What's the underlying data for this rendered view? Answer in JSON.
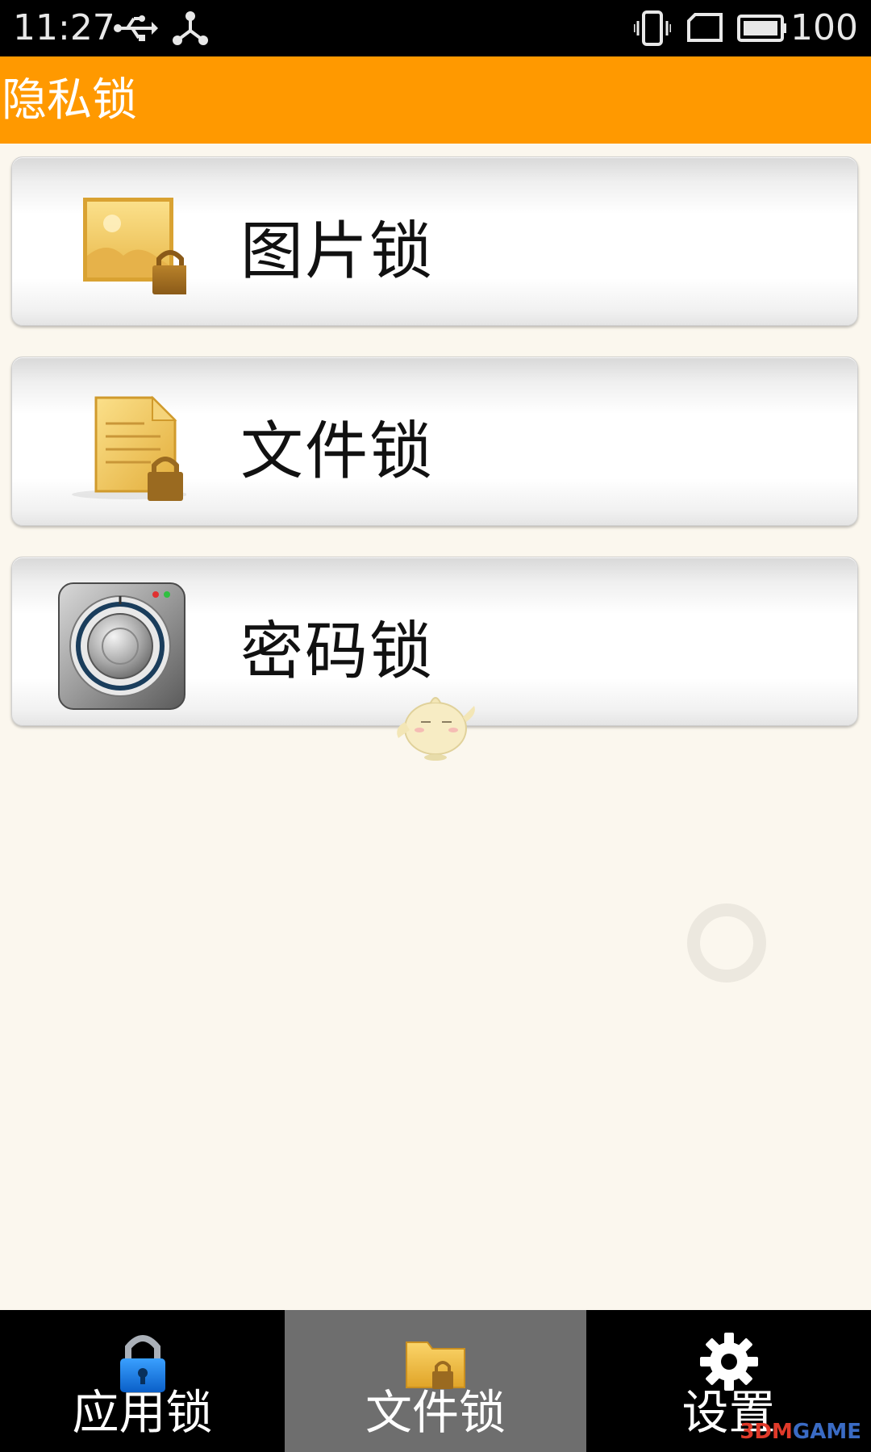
{
  "status_bar": {
    "time": "11:27",
    "battery_level": "100",
    "icons": [
      "usb-icon",
      "share-icon",
      "vibrate-icon",
      "sim-icon",
      "battery-icon"
    ]
  },
  "app_bar": {
    "title": "隐私锁",
    "color": "#ff9900"
  },
  "menu": {
    "items": [
      {
        "label": "图片锁",
        "icon": "image-lock-icon"
      },
      {
        "label": "文件锁",
        "icon": "file-lock-icon"
      },
      {
        "label": "密码锁",
        "icon": "safe-dial-icon"
      }
    ]
  },
  "tabs": {
    "items": [
      {
        "label": "应用锁",
        "icon": "padlock-icon",
        "active": false
      },
      {
        "label": "文件锁",
        "icon": "folder-lock-icon",
        "active": true
      },
      {
        "label": "设置",
        "icon": "gear-icon",
        "active": false
      }
    ]
  },
  "watermark": {
    "prefix": "3DM",
    "suffix": "GAME"
  }
}
